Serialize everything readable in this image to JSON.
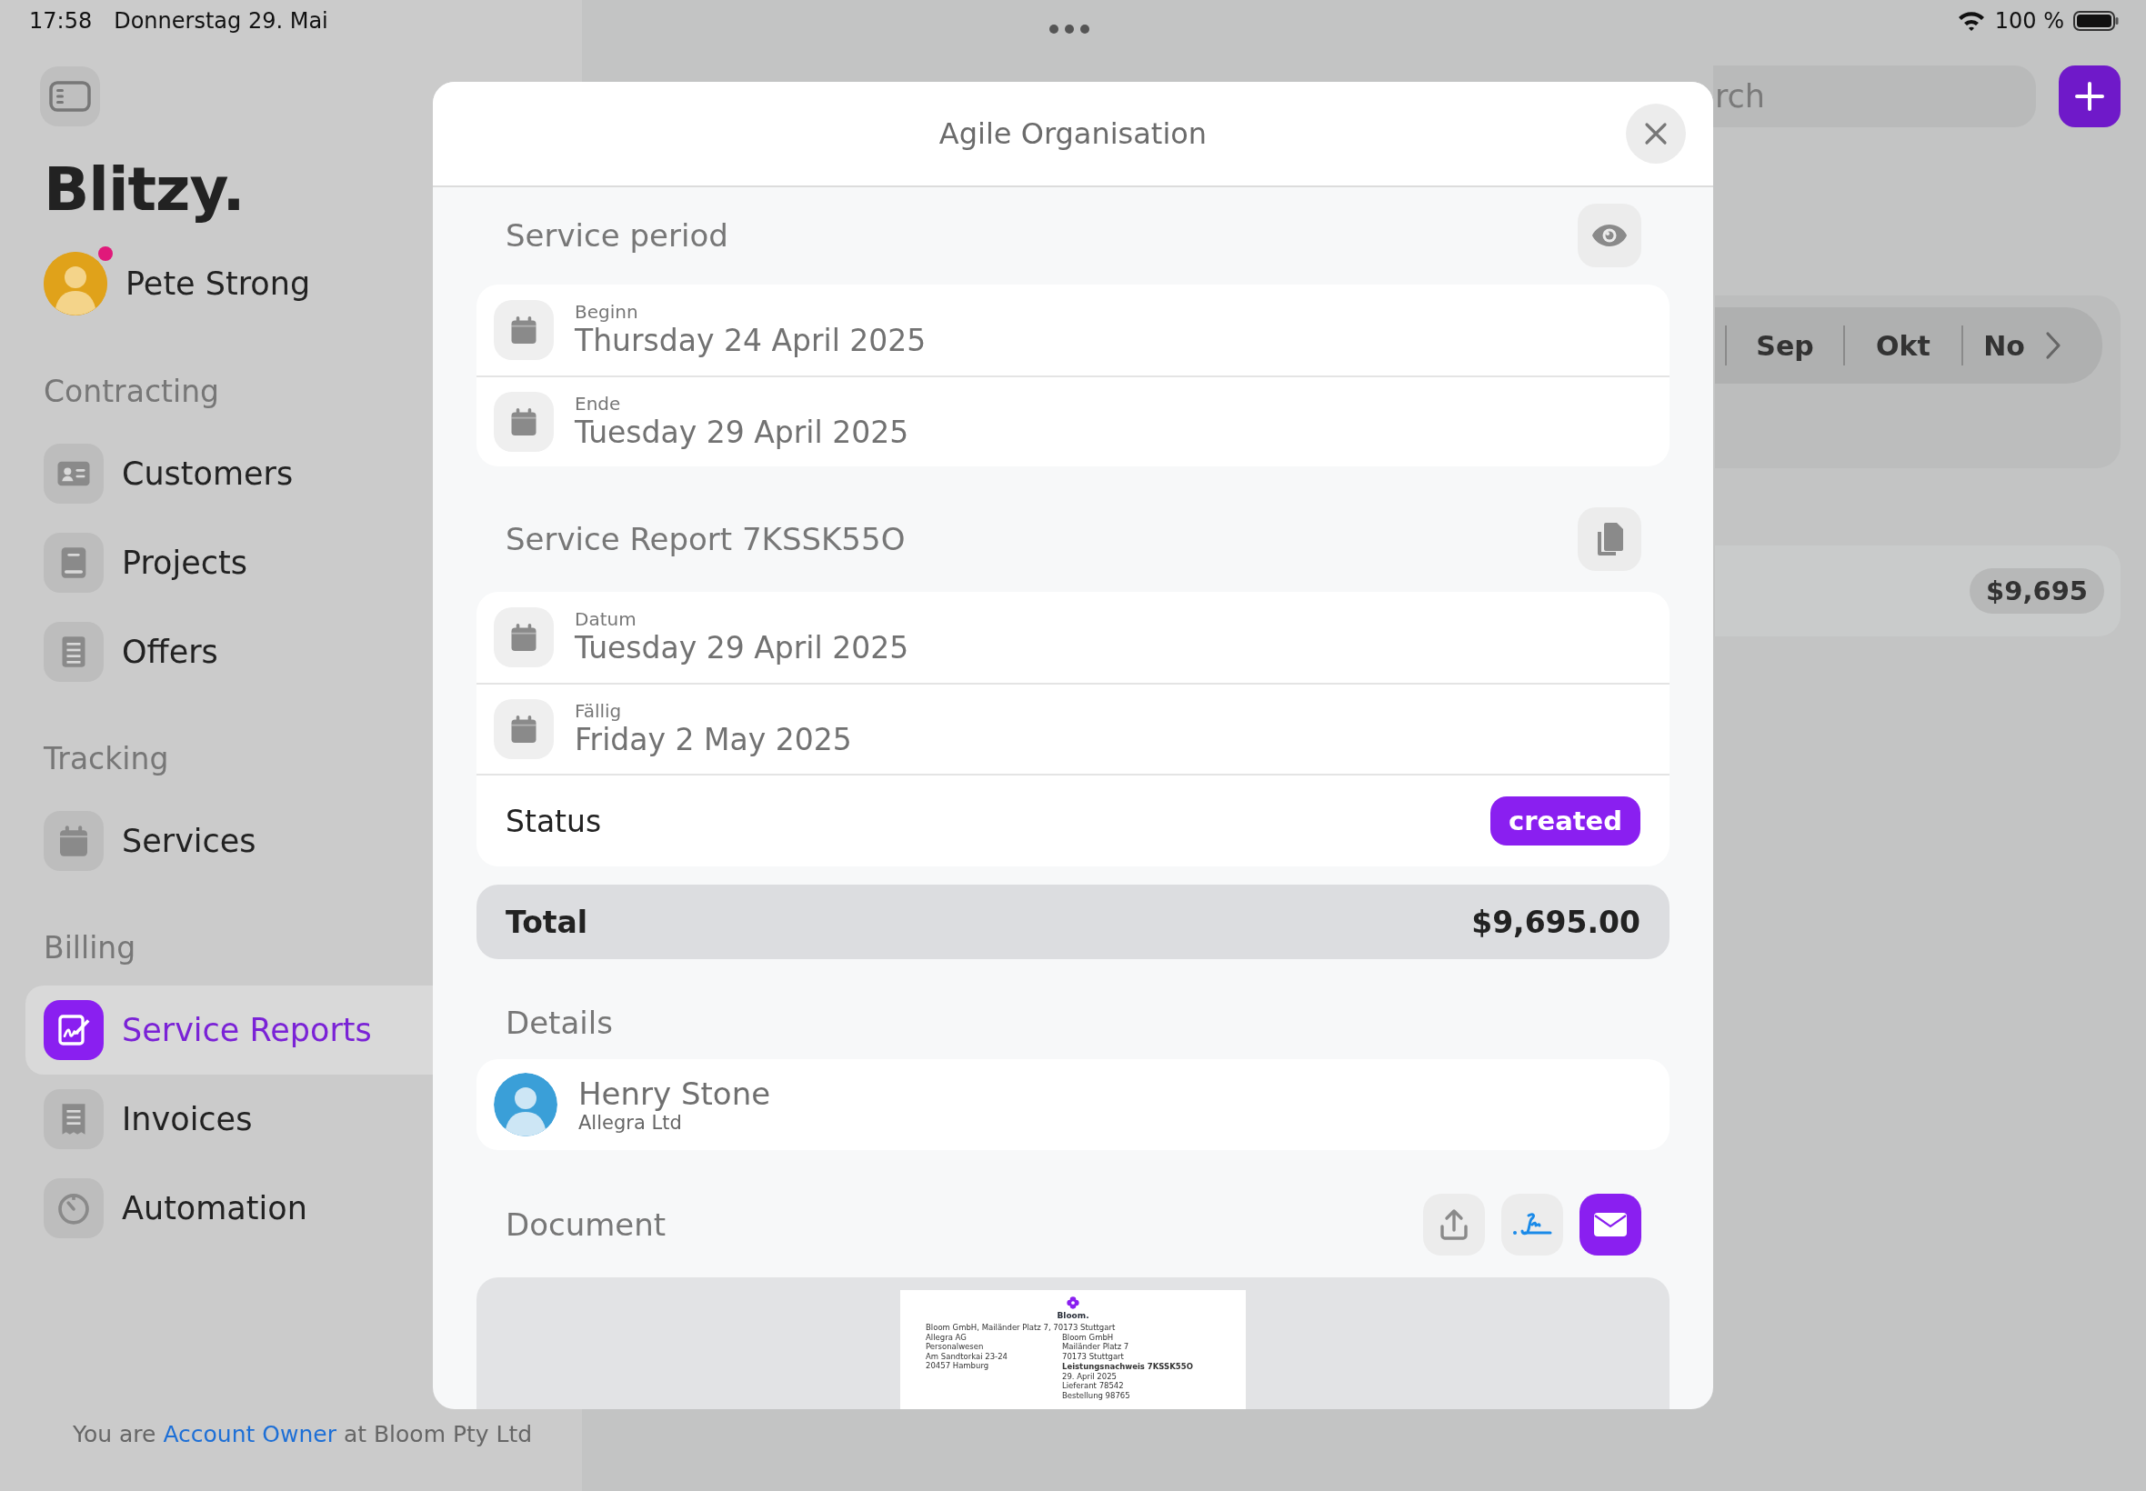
{
  "status_bar": {
    "time": "17:58",
    "date": "Donnerstag 29. Mai",
    "battery": "100 %"
  },
  "sidebar": {
    "app_title": "Blitzy.",
    "user": {
      "name": "Pete Strong",
      "notification": true
    },
    "sections": [
      {
        "title": "Contracting",
        "items": [
          {
            "label": "Customers",
            "selected": false
          },
          {
            "label": "Projects",
            "selected": false
          },
          {
            "label": "Offers",
            "selected": false
          }
        ]
      },
      {
        "title": "Tracking",
        "items": [
          {
            "label": "Services",
            "selected": false
          }
        ]
      },
      {
        "title": "Billing",
        "items": [
          {
            "label": "Service Reports",
            "selected": true
          },
          {
            "label": "Invoices",
            "selected": false
          },
          {
            "label": "Automation",
            "selected": false
          }
        ]
      }
    ],
    "footer": {
      "before": "You are ",
      "link": "Account Owner",
      "after": " at Bloom Pty Ltd"
    }
  },
  "main": {
    "search": {
      "placeholder": "rch"
    },
    "months": [
      {
        "label": "Sep"
      },
      {
        "label": "Okt"
      },
      {
        "label": "No"
      }
    ],
    "amount": "$9,695"
  },
  "modal": {
    "title": "Agile Organisation",
    "service_period": {
      "title": "Service period",
      "dates": [
        {
          "label": "Beginn",
          "value": "Thursday 24 April 2025"
        },
        {
          "label": "Ende",
          "value": "Tuesday 29 April 2025"
        }
      ]
    },
    "service_report": {
      "title": "Service Report 7KSSK55O",
      "dates": [
        {
          "label": "Datum",
          "value": "Tuesday 29 April 2025"
        },
        {
          "label": "Fällig",
          "value": "Friday 2 May 2025"
        }
      ],
      "status": {
        "label": "Status",
        "value": "created"
      }
    },
    "total": {
      "label": "Total",
      "amount": "$9,695.00"
    },
    "details": {
      "title": "Details",
      "contact": {
        "name": "Henry Stone",
        "company": "Allegra Ltd"
      }
    },
    "document": {
      "title": "Document",
      "preview": {
        "brand": "Bloom.",
        "sender_line": "Bloom GmbH, Mailänder Platz 7, 70173 Stuttgart",
        "recipient": [
          "Allegra AG",
          "Personalwesen",
          "Am Sandtorkai 23-24",
          "20457 Hamburg"
        ],
        "issuer": [
          "Bloom GmbH",
          "Mailänder Platz 7",
          "70173 Stuttgart"
        ],
        "report_title": "Leistungsnachweis 7KSSK55O",
        "report_meta": [
          "29. April 2025",
          "Lieferant 78542",
          "Bestellung 98765"
        ]
      }
    }
  }
}
